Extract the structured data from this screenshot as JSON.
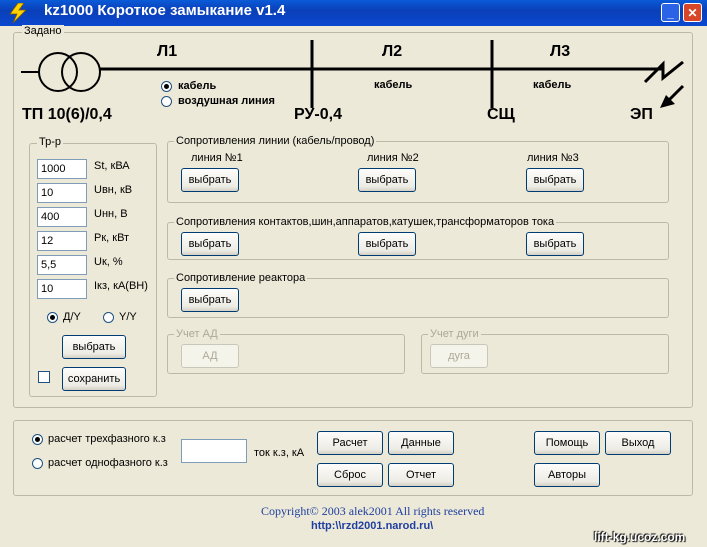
{
  "window": {
    "title": "kz1000 Короткое замыкание v1.4",
    "minimize": "_",
    "close": "✕"
  },
  "zadano": {
    "label": "Задано"
  },
  "diagram": {
    "l1": "Л1",
    "l2": "Л2",
    "l3": "Л3",
    "tp": "ТП 10(6)/0,4",
    "ru": "РУ-0,4",
    "sch": "СЩ",
    "ep": "ЭП",
    "radio_cable": "кабель",
    "radio_overhead": "воздушная линия",
    "l2_type": "кабель",
    "l3_type": "кабель"
  },
  "transformer": {
    "label": "Тр-р",
    "fields": [
      {
        "value": "1000",
        "label": "St, кВА"
      },
      {
        "value": "10",
        "label": "Uвн, кВ"
      },
      {
        "value": "400",
        "label": "Uнн, В"
      },
      {
        "value": "12",
        "label": "Pк, кВт"
      },
      {
        "value": "5,5",
        "label": "Uк, %"
      },
      {
        "value": "10",
        "label": "Iкз, кА(ВН)"
      }
    ],
    "radio_dy": "Д/Y",
    "radio_yy": "Y/Y",
    "select_btn": "выбрать",
    "save_btn": "сохранить"
  },
  "line_res": {
    "label": "Сопротивления линии (кабель/провод)",
    "l1": "линия №1",
    "l2": "линия №2",
    "l3": "линия №3",
    "btn": "выбрать"
  },
  "contact_res": {
    "label": "Сопротивления контактов,шин,аппаратов,катушек,трансформаторов тока",
    "btn": "выбрать"
  },
  "reactor": {
    "label": "Сопротивление реактора",
    "btn": "выбрать"
  },
  "ad": {
    "label": "Учет АД",
    "btn": "АД"
  },
  "arc": {
    "label": "Учет дуги",
    "btn": "дуга"
  },
  "calc": {
    "radio_three": "расчет трехфазного к.з",
    "radio_single": "расчет однофазного к.з",
    "result_value": "",
    "current_label": "ток к.з, кА",
    "btn_calc": "Расчет",
    "btn_data": "Данные",
    "btn_reset": "Сброс",
    "btn_report": "Отчет",
    "btn_help": "Помощь",
    "btn_exit": "Выход",
    "btn_authors": "Авторы"
  },
  "footer": {
    "copyright": "Copyright© 2003 alek2001 All rights reserved",
    "url": "http:\\\\rzd2001.narod.ru\\",
    "watermark": "lift-kg.ucoz.com"
  }
}
